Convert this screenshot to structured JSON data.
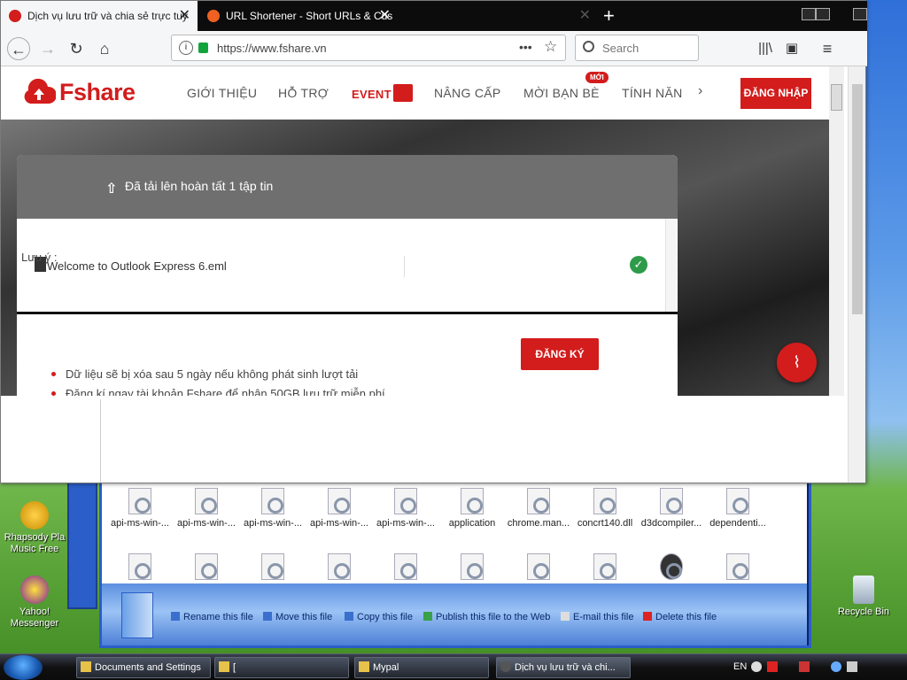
{
  "browser": {
    "tabs": [
      {
        "title": "Dịch vụ lưu trữ và chia sẻ trực tuy",
        "active": true
      },
      {
        "title": "URL Shortener - Short URLs & Cus",
        "active": false
      },
      {
        "title": "",
        "active": false
      }
    ],
    "url": "https://www.fshare.vn",
    "search_placeholder": "Search"
  },
  "site": {
    "logo_text": "Fshare",
    "nav": [
      "GIỚI THIỆU",
      "HỖ TRỢ",
      "EVENT",
      "NÂNG CẤP",
      "MỜI BẠN BÈ",
      "TÍNH NĂN"
    ],
    "badge": "MỚI",
    "login": "ĐĂNG NHẬP"
  },
  "upload": {
    "title": "Đã tải lên hoàn tất 1 tập tin",
    "file_name": "Welcome to Outlook Express 6.eml",
    "note_label": "Lưu ý :",
    "notes": [
      "Dữ liệu sẽ bị xóa sau 5 ngày nếu không phát sinh lượt tải",
      "Đăng kí ngay tài khoản Fshare để nhận 50GB lưu trữ miễn phí"
    ],
    "register": "ĐĂNG KÝ"
  },
  "explorer": {
    "files_row1": [
      "api-ms-win-...",
      "api-ms-win-...",
      "api-ms-win-...",
      "api-ms-win-...",
      "api-ms-win-...",
      "application",
      "chrome.man...",
      "concrt140.dll",
      "d3dcompiler...",
      "dependenti..."
    ],
    "tasks": [
      "Rename this file",
      "Move this file",
      "Copy this file",
      "Publish this file to the Web",
      "E-mail this file",
      "Delete this file"
    ]
  },
  "desktop": {
    "icons": [
      "Rhapsody Pla Music Free",
      "Yahoo! Messenger",
      "Recycle Bin"
    ]
  },
  "taskbar": {
    "items": [
      "Documents and Settings",
      "[",
      "Mypal",
      "Dịch vụ lưu trữ và chi..."
    ],
    "lang": "EN"
  },
  "colors": {
    "accent": "#d31c1c",
    "success": "#2e9b4a"
  }
}
